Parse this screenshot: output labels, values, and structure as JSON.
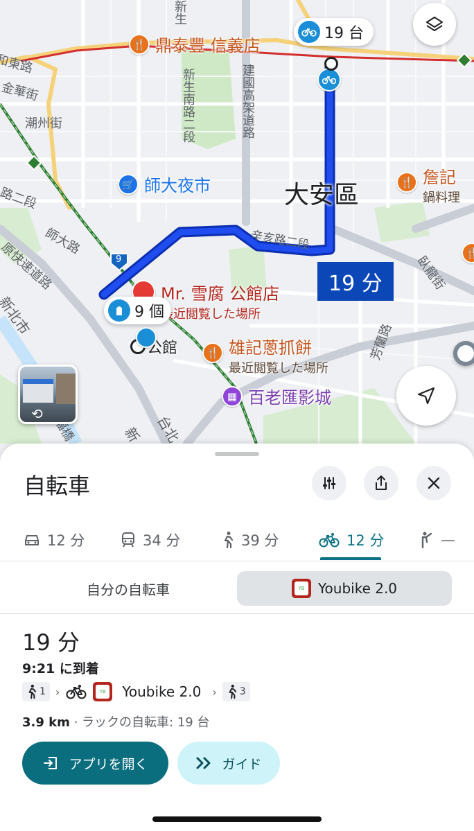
{
  "map": {
    "district": "大安區",
    "roads": [
      {
        "name": "新生",
        "color": "#5f6368"
      },
      {
        "name": "新生南路二段",
        "color": "#5f6368"
      },
      {
        "name": "建國高架道路",
        "color": "#5f6368"
      },
      {
        "name": "和東路",
        "color": "#5f6368"
      },
      {
        "name": "金華街",
        "color": "#5f6368"
      },
      {
        "name": "潮州街",
        "color": "#5f6368"
      },
      {
        "name": "路二段",
        "color": "#5f6368"
      },
      {
        "name": "師大路",
        "color": "#5f6368"
      },
      {
        "name": "原快速道路",
        "color": "#5f6368"
      },
      {
        "name": "辛亥路二段",
        "color": "#5f6368"
      },
      {
        "name": "臥龍街",
        "color": "#5f6368"
      },
      {
        "name": "芳蘭路",
        "color": "#5f6368"
      },
      {
        "name": "新北市",
        "color": "#5f6368"
      },
      {
        "name": "永福橋",
        "color": "#5f6368"
      },
      {
        "name": "新",
        "color": "#5f6368"
      },
      {
        "name": "台北",
        "color": "#5f6368"
      }
    ],
    "pois": {
      "dintaifung": {
        "name": "鼎泰豐 信義店",
        "color": "#c5561f"
      },
      "shida": {
        "name": "師大夜市",
        "color": "#1a73e8"
      },
      "yuanji": {
        "name": "詹記",
        "sub": "鍋料理",
        "color": "#c5561f"
      },
      "snowtofu": {
        "name": "Mr. 雪腐 公館店",
        "sub": "最近閲覧した場所",
        "color": "#b3261e"
      },
      "gongguan": {
        "name": "公館",
        "color": "#202124"
      },
      "xiongji": {
        "name": "雄記蔥抓餅",
        "sub": "最近閲覧した場所",
        "color": "#c5561f"
      },
      "cinema": {
        "name": "百老匯影城",
        "color": "#7b3fb1"
      }
    },
    "callout_bikes_top": "19 台",
    "callout_bikes_bottom": "9 個",
    "route_time": "19 分",
    "route_color": "#1a3cd9",
    "shield_number": "9"
  },
  "sheet": {
    "title": "自転車",
    "modes": [
      {
        "icon": "car-icon",
        "label": "12 分"
      },
      {
        "icon": "train-icon",
        "label": "34 分"
      },
      {
        "icon": "walk-icon",
        "label": "39 分"
      },
      {
        "icon": "bike-icon",
        "label": "12 分",
        "active": true
      },
      {
        "icon": "ride-icon",
        "label": "—"
      }
    ],
    "segment_own": "自分の自転車",
    "segment_share": "Youbike 2.0",
    "route": {
      "duration": "19 分",
      "arrival": "9:21 に到着",
      "walk_before": "1",
      "service": "Youbike 2.0",
      "walk_after": "3",
      "distance": "3.9 km",
      "rack_text": " · ラックの自転車: 19 台"
    },
    "open_app": "アプリを開く",
    "guide": "ガイド"
  },
  "colors": {
    "accent": "#0b6e7e",
    "accent_light": "#cef3f9",
    "route": "#1a3cd9",
    "bike_blue": "#1a8fd8",
    "food_orange": "#e8711c"
  }
}
